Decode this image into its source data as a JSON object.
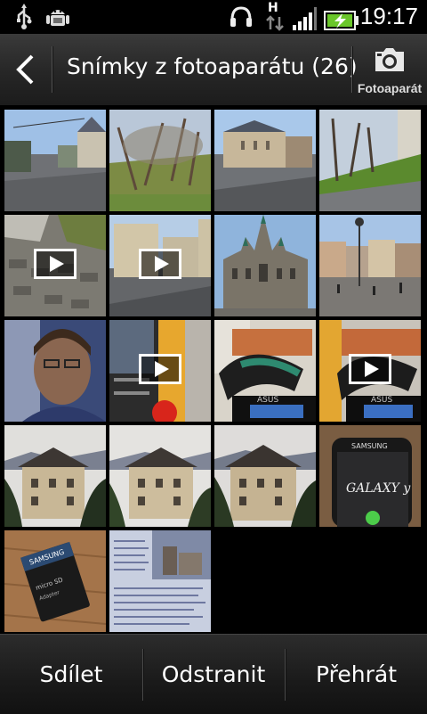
{
  "status_bar": {
    "time": "19:17",
    "network_type": "H",
    "icons": [
      "usb-icon",
      "android-debug-icon",
      "headset-icon",
      "data-transfer-icon",
      "signal-icon",
      "battery-charging-icon"
    ]
  },
  "action_bar": {
    "title": "Snímky z fotoaparátu (26)",
    "camera_label": "Fotoaparát"
  },
  "gallery": {
    "items": [
      {
        "type": "photo",
        "scene": "street-church"
      },
      {
        "type": "photo",
        "scene": "park-trees"
      },
      {
        "type": "photo",
        "scene": "theatre-square"
      },
      {
        "type": "photo",
        "scene": "tower-grass"
      },
      {
        "type": "video",
        "scene": "cobblestone"
      },
      {
        "type": "video",
        "scene": "street-house"
      },
      {
        "type": "photo",
        "scene": "town-hall"
      },
      {
        "type": "photo",
        "scene": "square-buildings"
      },
      {
        "type": "photo",
        "scene": "selfie"
      },
      {
        "type": "video",
        "scene": "room-shelf"
      },
      {
        "type": "photo",
        "scene": "asus-laptop"
      },
      {
        "type": "video",
        "scene": "asus-laptop-2"
      },
      {
        "type": "photo",
        "scene": "house-1"
      },
      {
        "type": "photo",
        "scene": "house-2"
      },
      {
        "type": "photo",
        "scene": "house-3"
      },
      {
        "type": "photo",
        "scene": "samsung-phone"
      },
      {
        "type": "photo",
        "scene": "sd-card"
      },
      {
        "type": "photo",
        "scene": "book-page"
      }
    ]
  },
  "bottom_bar": {
    "share": "Sdílet",
    "delete": "Odstranit",
    "play": "Přehrát"
  }
}
